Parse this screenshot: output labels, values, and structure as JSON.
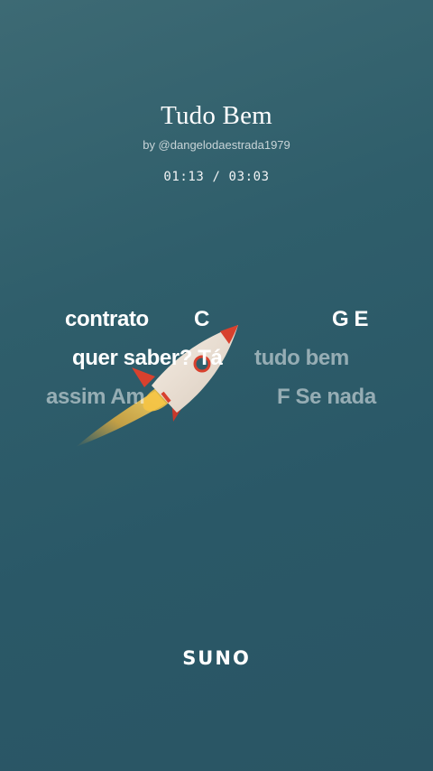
{
  "song": {
    "title": "Tudo Bem",
    "byline": "by @dangelodaestrada1979",
    "time": "01:13 / 03:03"
  },
  "lyrics": {
    "line1": {
      "word1": "contrato",
      "chord1": "C",
      "chord2": "G E"
    },
    "line2": {
      "sung": "quer saber? Tá",
      "upcoming": "tudo bem"
    },
    "line3": {
      "left": "assim Am",
      "right": "F Se nada"
    }
  },
  "footer": {
    "logo": "SUNO"
  },
  "icons": {
    "artwork": "rocket-icon"
  },
  "colors": {
    "background_top": "#3d6a74",
    "background_bottom": "#2a5564",
    "text_active": "#ffffff"
  }
}
